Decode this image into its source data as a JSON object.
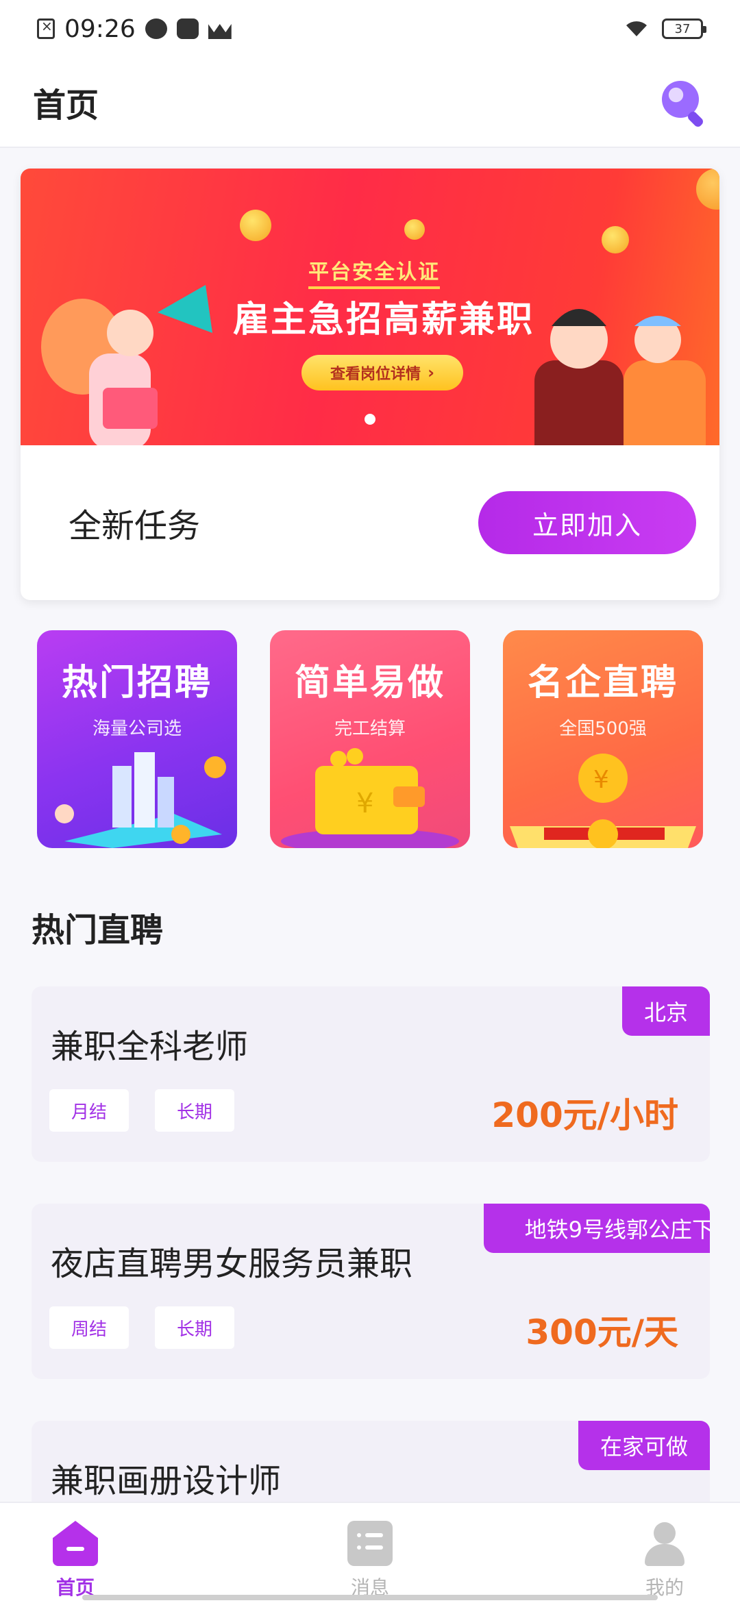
{
  "status_bar": {
    "time": "09:26",
    "battery": "37"
  },
  "header": {
    "title": "首页",
    "search_icon": "search-icon"
  },
  "banner": {
    "badge": "平台安全认证",
    "headline": "雇主急招高薪兼职",
    "cta_label": "查看岗位详情",
    "colors": {
      "start": "#ff4a3a",
      "end": "#ff6a2a"
    }
  },
  "task_card": {
    "title": "全新任务",
    "button_label": "立即加入"
  },
  "categories": [
    {
      "title": "热门招聘",
      "subtitle": "海量公司选"
    },
    {
      "title": "简单易做",
      "subtitle": "完工结算"
    },
    {
      "title": "名企直聘",
      "subtitle": "全国500强"
    }
  ],
  "section": {
    "title": "热门直聘"
  },
  "jobs": [
    {
      "title": "兼职全科老师",
      "tags": [
        "月结",
        "长期"
      ],
      "pay": "200元/小时",
      "location": "北京"
    },
    {
      "title": "夜店直聘男女服务员兼职",
      "tags": [
        "周结",
        "长期"
      ],
      "pay": "300元/天",
      "location": "地铁9号线郭公庄下"
    },
    {
      "title": "兼职画册设计师",
      "tags": [],
      "pay": "",
      "location": "在家可做"
    }
  ],
  "bottom_nav": [
    {
      "label": "首页",
      "icon": "home-icon",
      "active": true
    },
    {
      "label": "消息",
      "icon": "message-icon",
      "active": false
    },
    {
      "label": "我的",
      "icon": "profile-icon",
      "active": false
    }
  ],
  "accent_color": "#b531ea",
  "price_color": "#ef6a1f"
}
